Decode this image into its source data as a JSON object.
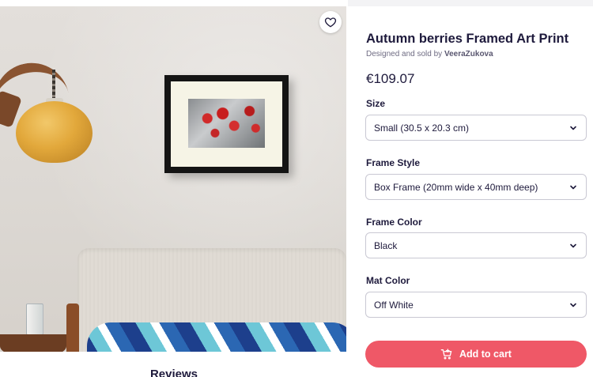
{
  "product": {
    "title": "Autumn berries Framed Art Print",
    "byline_prefix": "Designed and sold by",
    "artist": "VeeraZukova",
    "price": "€109.07"
  },
  "options": [
    {
      "label": "Size",
      "value": "Small (30.5 x 20.3 cm)"
    },
    {
      "label": "Frame Style",
      "value": "Box Frame (20mm wide x 40mm deep)"
    },
    {
      "label": "Frame Color",
      "value": "Black"
    },
    {
      "label": "Mat Color",
      "value": "Off White"
    }
  ],
  "actions": {
    "add_to_cart": "Add to cart",
    "favorite_icon": "heart-icon"
  },
  "reviews": {
    "heading": "Reviews"
  },
  "colors": {
    "accent": "#ef5867",
    "text": "#1e1a3c",
    "muted": "#6f6c83",
    "border": "#c9c8d3"
  }
}
